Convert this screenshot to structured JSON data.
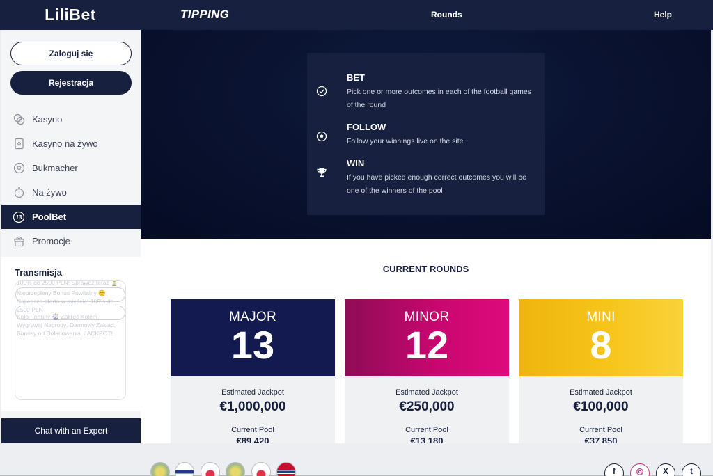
{
  "header": {
    "logo": "LiliBet",
    "product": "TIPPING",
    "nav": {
      "rounds": "Rounds",
      "help": "Help"
    }
  },
  "sidebar": {
    "login_label": "Zaloguj się",
    "register_label": "Rejestracja",
    "items": [
      {
        "label": "Kasyno",
        "icon": "casino-chip-icon"
      },
      {
        "label": "Kasyno na żywo",
        "icon": "live-casino-card-icon"
      },
      {
        "label": "Bukmacher",
        "icon": "football-icon"
      },
      {
        "label": "Na żywo",
        "icon": "stopwatch-icon"
      },
      {
        "label": "PoolBet",
        "icon": "number-13-icon"
      },
      {
        "label": "Promocje",
        "icon": "gift-icon"
      }
    ],
    "active_item": "PoolBet",
    "stream": {
      "title": "Transmisja",
      "promo_line_1": "100% do 2500 PLN! Sprawdź teraz ⏳",
      "promo_line_2": "Nieprzepłeny Bonus Powitalny 😊 Najlepsza oferta w mieście! 100% do 2500 PLN",
      "promo_line_3": "Koło Fortuny 🎡 Zakręć Kołem, Wygrywaj Nagrody: Darmowy Zakład, Bonusy od Doładowania, JACKPOT!"
    },
    "chat_label": "Chat with an Expert"
  },
  "hero": {
    "steps": [
      {
        "icon": "check-circle-icon",
        "title": "BET",
        "desc": "Pick one or more outcomes in each of the football games of the round"
      },
      {
        "icon": "football-icon",
        "title": "FOLLOW",
        "desc": "Follow your winnings live on the site"
      },
      {
        "icon": "trophy-icon",
        "title": "WIN",
        "desc": "If you have picked enough correct outcomes you will be one of the winners of the pool"
      }
    ]
  },
  "rounds": {
    "title": "CURRENT ROUNDS",
    "cards": [
      {
        "name": "MAJOR",
        "number": "13",
        "jackpot_label": "Estimated Jackpot",
        "jackpot": "€1,000,000",
        "pool_label": "Current Pool",
        "pool": "€89,420",
        "color": "#131a4f"
      },
      {
        "name": "MINOR",
        "number": "12",
        "jackpot_label": "Estimated Jackpot",
        "jackpot": "€250,000",
        "pool_label": "Current Pool",
        "pool": "€13,180",
        "color": "#c7076f"
      },
      {
        "name": "MINI",
        "number": "8",
        "jackpot_label": "Estimated Jackpot",
        "jackpot": "€100,000",
        "pool_label": "Current Pool",
        "pool": "€37,850",
        "color": "#f3c21b"
      }
    ]
  },
  "footer": {
    "flags": [
      "brazil-flag-icon",
      "finland-flag-icon",
      "japan-flag-icon",
      "brazil-flag-icon",
      "japan-flag-icon",
      "norway-flag-icon"
    ],
    "social": [
      "facebook-icon",
      "instagram-icon",
      "x-icon",
      "tumblr-icon"
    ]
  }
}
